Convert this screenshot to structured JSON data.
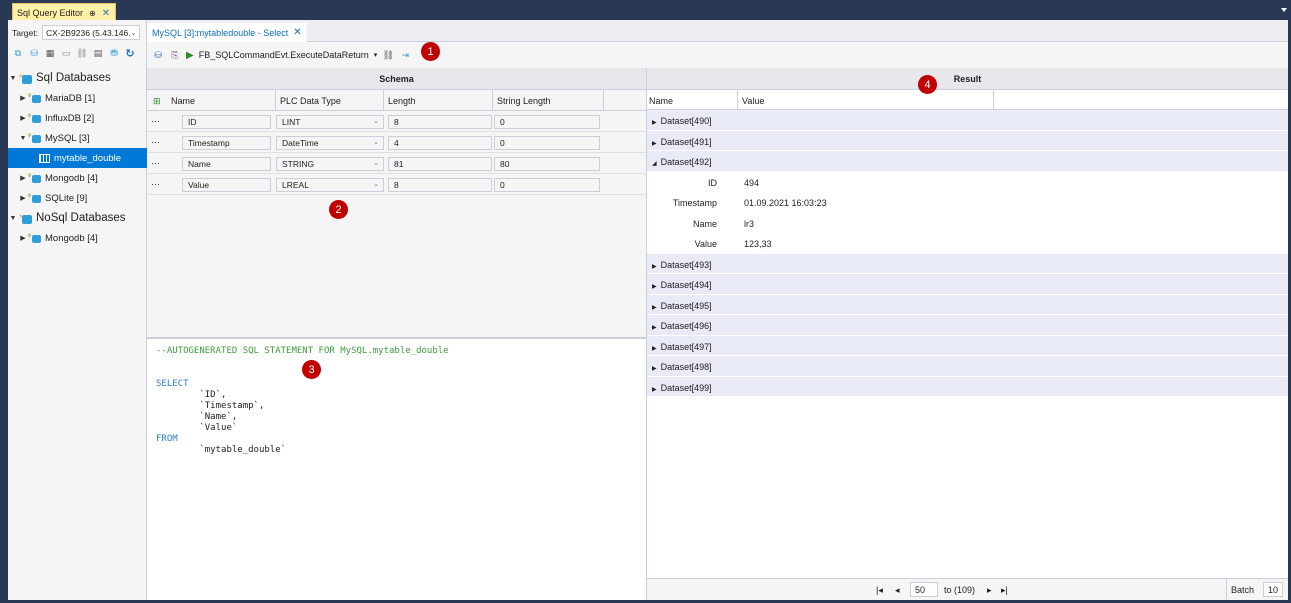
{
  "window": {
    "title": "Sql Query Editor",
    "pin_icon": "pin-icon",
    "close_icon": "close-icon"
  },
  "left": {
    "target_label": "Target:",
    "target_value": "CX-2B9236 (5.43.146.",
    "tree": {
      "sql_databases": "Sql Databases",
      "mariadb": "MariaDB [1]",
      "influxdb": "InfluxDB [2]",
      "mysql": "MySQL [3]",
      "mytable": "mytable_double",
      "mongodb": "Mongodb [4]",
      "sqlite": "SQLite [9]",
      "nosql_databases": "NoSql Databases",
      "nosql_mongodb": "Mongodb [4]"
    }
  },
  "doc_tab": {
    "label": "MySQL [3]:mytabledouble - Select"
  },
  "toolbar": {
    "function_block": "FB_SQLCommandEvt.ExecuteDataReturn"
  },
  "badges": {
    "b1": "1",
    "b2": "2",
    "b3": "3",
    "b4": "4"
  },
  "schema": {
    "title": "Schema",
    "headers": {
      "name": "Name",
      "type": "PLC Data Type",
      "length": "Length",
      "strlen": "String Length"
    },
    "rows": [
      {
        "dots": "···",
        "name": "ID",
        "type": "LINT",
        "length": "8",
        "strlen": "0"
      },
      {
        "dots": "···",
        "name": "Timestamp",
        "type": "DateTime",
        "length": "4",
        "strlen": "0"
      },
      {
        "dots": "···",
        "name": "Name",
        "type": "STRING",
        "length": "81",
        "strlen": "80"
      },
      {
        "dots": "···",
        "name": "Value",
        "type": "LREAL",
        "length": "8",
        "strlen": "0"
      }
    ]
  },
  "sql": {
    "comment": "--AUTOGENERATED SQL STATEMENT FOR MySQL.mytable_double",
    "select": "SELECT",
    "col1": "        `ID`,",
    "col2": "        `Timestamp`,",
    "col3": "        `Name`,",
    "col4": "        `Value`",
    "from": "FROM",
    "table": "        `mytable_double`"
  },
  "result": {
    "title": "Result",
    "headers": {
      "name": "Name",
      "value": "Value"
    },
    "ds490": "Dataset[490]",
    "ds491": "Dataset[491]",
    "ds492": "Dataset[492]",
    "fields": [
      {
        "k": "ID",
        "v": "494"
      },
      {
        "k": "Timestamp",
        "v": "01.09.2021 16:03:23"
      },
      {
        "k": "Name",
        "v": "lr3"
      },
      {
        "k": "Value",
        "v": "123,33"
      }
    ],
    "ds493": "Dataset[493]",
    "ds494": "Dataset[494]",
    "ds495": "Dataset[495]",
    "ds496": "Dataset[496]",
    "ds497": "Dataset[497]",
    "ds498": "Dataset[498]",
    "ds499": "Dataset[499]"
  },
  "pager": {
    "first": "|◂",
    "prev": "◂",
    "page": "50",
    "to": "to (109)",
    "next": "▸",
    "last": "▸|",
    "batch_label": "Batch",
    "batch_value": "10"
  }
}
